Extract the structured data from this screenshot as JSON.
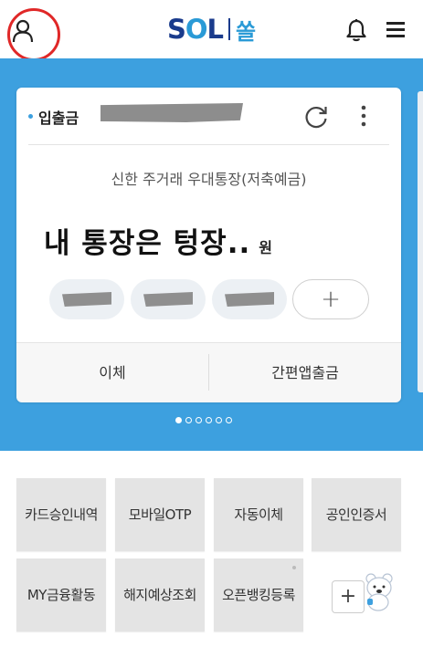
{
  "header": {
    "logo_text": "SOL",
    "logo_ko": "쏠",
    "profile_icon": "user-icon",
    "bell_icon": "bell-icon",
    "menu_icon": "hamburger-menu-icon",
    "highlight_color": "#e02828"
  },
  "theme": {
    "blue": "#3da0df",
    "navy": "#1a3b8c"
  },
  "account_card": {
    "label": "입출금",
    "product_name": "신한 주거래 우대통장(저축예금)",
    "balance_text": "내 통장은 텅장..",
    "currency": "원",
    "chip_add": "+",
    "actions": [
      "이체",
      "간편앱출금"
    ],
    "page_count": 6,
    "active_page": 0
  },
  "quick_menu": {
    "tiles": [
      "카드승인내역",
      "모바일OTP",
      "자동이체",
      "공인인증서",
      "MY금융활동",
      "해지예상조회",
      "오픈뱅킹등록"
    ],
    "add_label": "+"
  }
}
